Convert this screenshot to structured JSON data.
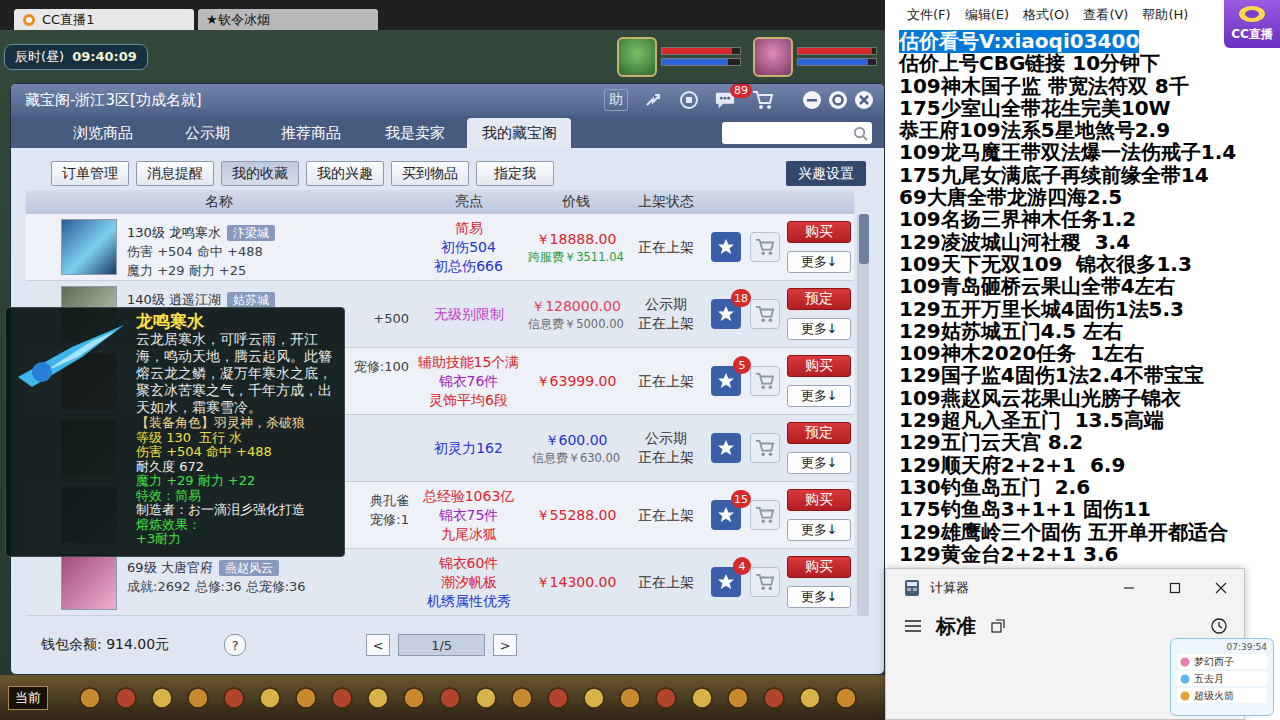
{
  "browser_tabs": [
    {
      "label": "CC直播1",
      "selected": true
    },
    {
      "label": "★钦令冰烟",
      "selected": false
    }
  ],
  "hud": {
    "period": "辰时(昼)",
    "clock": "09:40:09",
    "party": [
      {
        "bars": [
          {
            "level": 0.9,
            "color": "#d42a2a"
          },
          {
            "level": 0.85,
            "color": "#2f64d8"
          }
        ]
      },
      {
        "bars": [
          {
            "level": 0.95,
            "color": "#d42a2a"
          },
          {
            "level": 0.9,
            "color": "#2f64d8"
          }
        ]
      }
    ]
  },
  "cbg": {
    "title": "藏宝阁-浙江3区[功成名就]",
    "help": "助",
    "message_badge": "89",
    "tabs": [
      {
        "label": "浏览商品",
        "selected": false
      },
      {
        "label": "公示期",
        "selected": false
      },
      {
        "label": "推荐商品",
        "selected": false
      },
      {
        "label": "我是卖家",
        "selected": false
      },
      {
        "label": "我的藏宝阁",
        "selected": true
      }
    ],
    "subtabs": [
      {
        "label": "订单管理",
        "selected": false
      },
      {
        "label": "消息提醒",
        "selected": false
      },
      {
        "label": "我的收藏",
        "selected": true
      },
      {
        "label": "我的兴趣",
        "selected": false
      },
      {
        "label": "买到物品",
        "selected": false
      },
      {
        "label": "指定我",
        "selected": false
      }
    ],
    "interest_settings": "兴趣设置",
    "columns": [
      "名称",
      "亮点",
      "价钱",
      "上架状态"
    ],
    "rows": [
      {
        "lines": [
          {
            "text": "130级 龙鸣寒水",
            "tag": "汴梁城",
            "kind": "title"
          },
          {
            "text": "伤害 +504 命中 +488",
            "tag": "",
            "kind": "full"
          },
          {
            "text": "魔力 +29 耐力 +25",
            "tag": "",
            "kind": "full"
          }
        ],
        "highlights": [
          {
            "text": "简易",
            "color": "#e0202a"
          },
          {
            "text": "初伤504",
            "color": "#2233cc"
          },
          {
            "text": "初总伤666",
            "color": "#2233cc"
          }
        ],
        "price": "￥18888.00",
        "price_color": "#e0202a",
        "fee": "跨服费￥3511.04",
        "fee_color": "#1f9a3c",
        "status": [
          "正在上架"
        ],
        "badge": "",
        "action": "购买",
        "more": "更多↓"
      },
      {
        "lines": [
          {
            "text": "140级 逍遥江湖",
            "tag": "姑苏城",
            "kind": "title"
          },
          {
            "text": "+500",
            "tag": "",
            "kind": "fragment"
          }
        ],
        "highlights": [
          {
            "text": "无级别限制",
            "color": "#c03cc8"
          }
        ],
        "price": "￥128000.00",
        "price_color": "#e04060",
        "fee": "信息费￥5000.00",
        "fee_color": "#666a75",
        "status": [
          "公示期",
          "正在上架"
        ],
        "badge": "18",
        "action": "预定",
        "more": "更多↓"
      },
      {
        "lines": [
          {
            "text": "宠修:100",
            "tag": "",
            "kind": "fragment"
          }
        ],
        "highlights": [
          {
            "text": "辅助技能15个满",
            "color": "#e0202a"
          },
          {
            "text": "锦衣76件",
            "color": "#a020c0"
          },
          {
            "text": "灵饰平均6段",
            "color": "#e0202a"
          }
        ],
        "price": "￥63999.00",
        "price_color": "#e0202a",
        "fee": "",
        "fee_color": "#666a75",
        "status": [
          "正在上架"
        ],
        "badge": "5",
        "action": "购买",
        "more": "更多↓"
      },
      {
        "lines": [],
        "highlights": [
          {
            "text": "初灵力162",
            "color": "#2233cc"
          }
        ],
        "price": "￥600.00",
        "price_color": "#2233cc",
        "fee": "信息费￥630.00",
        "fee_color": "#666a75",
        "status": [
          "公示期",
          "正在上架"
        ],
        "badge": "",
        "action": "预定",
        "more": "更多↓"
      },
      {
        "lines": [
          {
            "text": "典孔雀",
            "tag": "",
            "kind": "fragment"
          },
          {
            "text": "宠修:1",
            "tag": "",
            "kind": "fragment"
          }
        ],
        "highlights": [
          {
            "text": "总经验1063亿",
            "color": "#e0202a"
          },
          {
            "text": "锦衣75件",
            "color": "#a020c0"
          },
          {
            "text": "九尾冰狐",
            "color": "#e0202a"
          }
        ],
        "price": "￥55288.00",
        "price_color": "#e0202a",
        "fee": "",
        "fee_color": "#666a75",
        "status": [
          "正在上架"
        ],
        "badge": "15",
        "action": "购买",
        "more": "更多↓"
      },
      {
        "lines": [
          {
            "text": "69级 大唐官府",
            "tag": "燕赵风云",
            "kind": "title"
          },
          {
            "text": "成就:2692 总修:36 总宠修:36",
            "tag": "",
            "kind": "full"
          }
        ],
        "highlights": [
          {
            "text": "锦衣60件",
            "color": "#e0202a"
          },
          {
            "text": "潮汐帆板",
            "color": "#e0202a"
          },
          {
            "text": "机绣属性优秀",
            "color": "#2233cc"
          }
        ],
        "price": "￥14300.00",
        "price_color": "#e0202a",
        "fee": "",
        "fee_color": "#666a75",
        "status": [
          "正在上架"
        ],
        "badge": "4",
        "action": "购买",
        "more": "更多↓"
      }
    ],
    "scroll_position": 0,
    "wallet": "钱包余额: 914.00元",
    "help_mark": "?",
    "pager": {
      "prev": "<",
      "page": "1/5",
      "next": ">"
    }
  },
  "tooltip": {
    "title": "龙鸣寒水",
    "description": "云龙居寒水，可呼云雨，开江海，鸣动天地，腾云起风。此簪熔云龙之鳞，凝万年寒水之底，聚玄冰苦寒之气，千年方成，出天如水，霜寒雪冷。",
    "lines": [
      {
        "text": "【装备角色】羽灵神，杀破狼",
        "color": "#f0d890"
      },
      {
        "text": "等级 130  五行 水",
        "color": "#f0e040"
      },
      {
        "text": "伤害 +504 命中 +488",
        "color": "#f0e040"
      },
      {
        "text": "耐久度 672",
        "color": "#f0f0f0"
      },
      {
        "text": "魔力 +29 耐力 +22",
        "color": "#40e040"
      },
      {
        "text": "特效：简易",
        "color": "#40e040"
      },
      {
        "text": "制造者：お一滴泪彡强化打造",
        "color": "#f0f0f0"
      },
      {
        "text": "熔炼效果：",
        "color": "#40e040"
      },
      {
        "text": "+3耐力",
        "color": "#40e040"
      }
    ]
  },
  "bottom_bar": {
    "channel": "当前"
  },
  "notepad": {
    "menu": [
      "文件(F)",
      "编辑(E)",
      "格式(O)",
      "查看(V)",
      "帮助(H)"
    ],
    "lines": [
      {
        "text": "估价看号V:xiaoqi03400",
        "selected": true
      },
      {
        "text": "估价上号CBG链接 10分钟下",
        "selected": false
      },
      {
        "text": "109神木国子监 带宽法符双 8千",
        "selected": false
      },
      {
        "text": "175少室山全带花生完美10W",
        "selected": false
      },
      {
        "text": "恭王府109法系5星地煞号2.9",
        "selected": false
      },
      {
        "text": "109龙马魔王带双法爆一法伤戒子1.4",
        "selected": false
      },
      {
        "text": "175九尾女满底子再续前缘全带14",
        "selected": false
      },
      {
        "text": "69大唐全带龙游四海2.5",
        "selected": false
      },
      {
        "text": "109名扬三界神木任务1.2",
        "selected": false
      },
      {
        "text": "129凌波城山河社稷  3.4",
        "selected": false
      },
      {
        "text": "109天下无双109  锦衣很多1.3",
        "selected": false
      },
      {
        "text": "109青岛砸桥云果山全带4左右",
        "selected": false
      },
      {
        "text": "129五开万里长城4固伤1法5.3",
        "selected": false
      },
      {
        "text": "129姑苏城五门4.5 左右",
        "selected": false
      },
      {
        "text": "109神木2020任务  1左右",
        "selected": false
      },
      {
        "text": "129国子监4固伤1法2.4不带宝宝",
        "selected": false
      },
      {
        "text": "109燕赵风云花果山光膀子锦衣",
        "selected": false
      },
      {
        "text": "129超凡入圣五门  13.5高端",
        "selected": false
      },
      {
        "text": "129五门云天宫 8.2",
        "selected": false
      },
      {
        "text": "129顺天府2+2+1  6.9",
        "selected": false
      },
      {
        "text": "130钓鱼岛五门  2.6",
        "selected": false
      },
      {
        "text": "175钓鱼岛3+1+1 固伤11",
        "selected": false
      },
      {
        "text": "129雄鹰岭三个固伤 五开单开都适合",
        "selected": false
      },
      {
        "text": "129黄金台2+2+1 3.6",
        "selected": false
      }
    ]
  },
  "calculator": {
    "title": "计算器",
    "mode": "标准"
  },
  "logo": "CC直播",
  "widget": {
    "time": "07:39:54",
    "items": [
      "梦幻西子",
      "五去月",
      "超级火箭"
    ]
  }
}
